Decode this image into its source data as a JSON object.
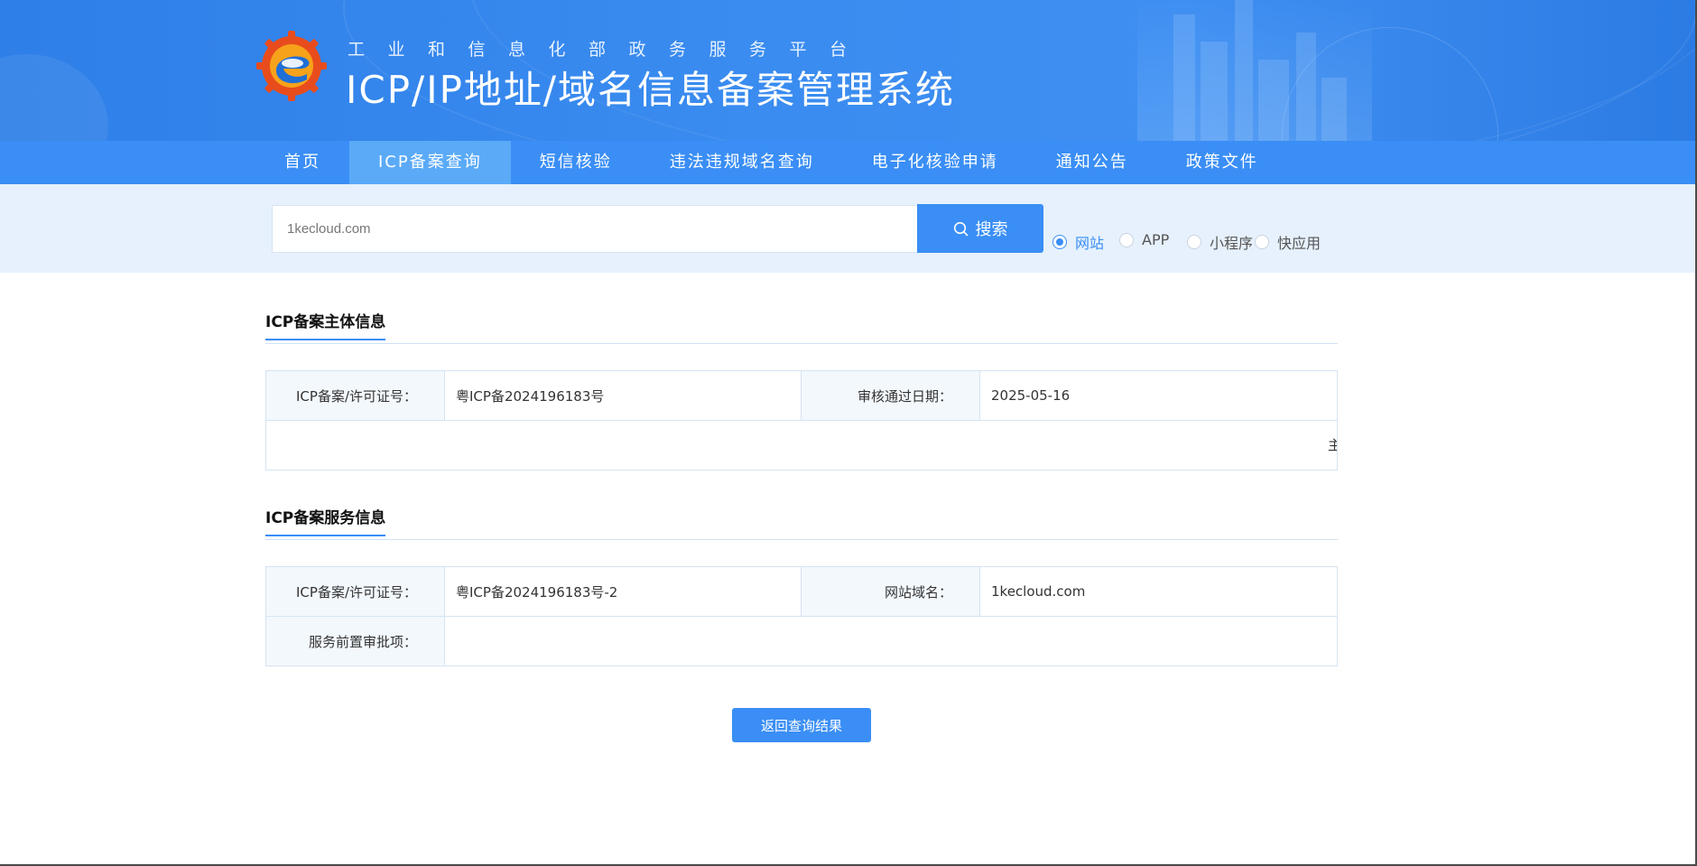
{
  "header": {
    "subtitle": "工业和信息化部政务服务平台",
    "title": "ICP/IP地址/域名信息备案管理系统"
  },
  "nav": {
    "items": [
      {
        "label": "首页"
      },
      {
        "label": "ICP备案查询"
      },
      {
        "label": "短信核验"
      },
      {
        "label": "违法违规域名查询"
      },
      {
        "label": "电子化核验申请"
      },
      {
        "label": "通知公告"
      },
      {
        "label": "政策文件"
      }
    ],
    "active_index": 1
  },
  "search": {
    "value": "1kecloud.com",
    "button_label": "搜索",
    "options": [
      {
        "label": "网站",
        "checked": true
      },
      {
        "label": "APP",
        "checked": false
      },
      {
        "label": "小程序",
        "checked": false
      },
      {
        "label": "快应用",
        "checked": false
      }
    ]
  },
  "subject_info": {
    "title": "ICP备案主体信息",
    "license_label": "ICP备案/许可证号：",
    "license_value": "粤ICP备2024196183号",
    "approve_date_label": "审核通过日期：",
    "approve_date_value": "2025-05-16",
    "overflow_text": "主"
  },
  "service_info": {
    "title": "ICP备案服务信息",
    "license_label": "ICP备案/许可证号：",
    "license_value": "粤ICP备2024196183号-2",
    "domain_label": "网站域名：",
    "domain_value": "1kecloud.com",
    "pre_approval_label": "服务前置审批项：",
    "pre_approval_value": ""
  },
  "back_button_label": "返回查询结果",
  "colors": {
    "primary": "#3a8ef5",
    "nav_active": "#5aaaf8",
    "search_band": "#e6f1fd",
    "key_cell": "#f3f8fd"
  }
}
